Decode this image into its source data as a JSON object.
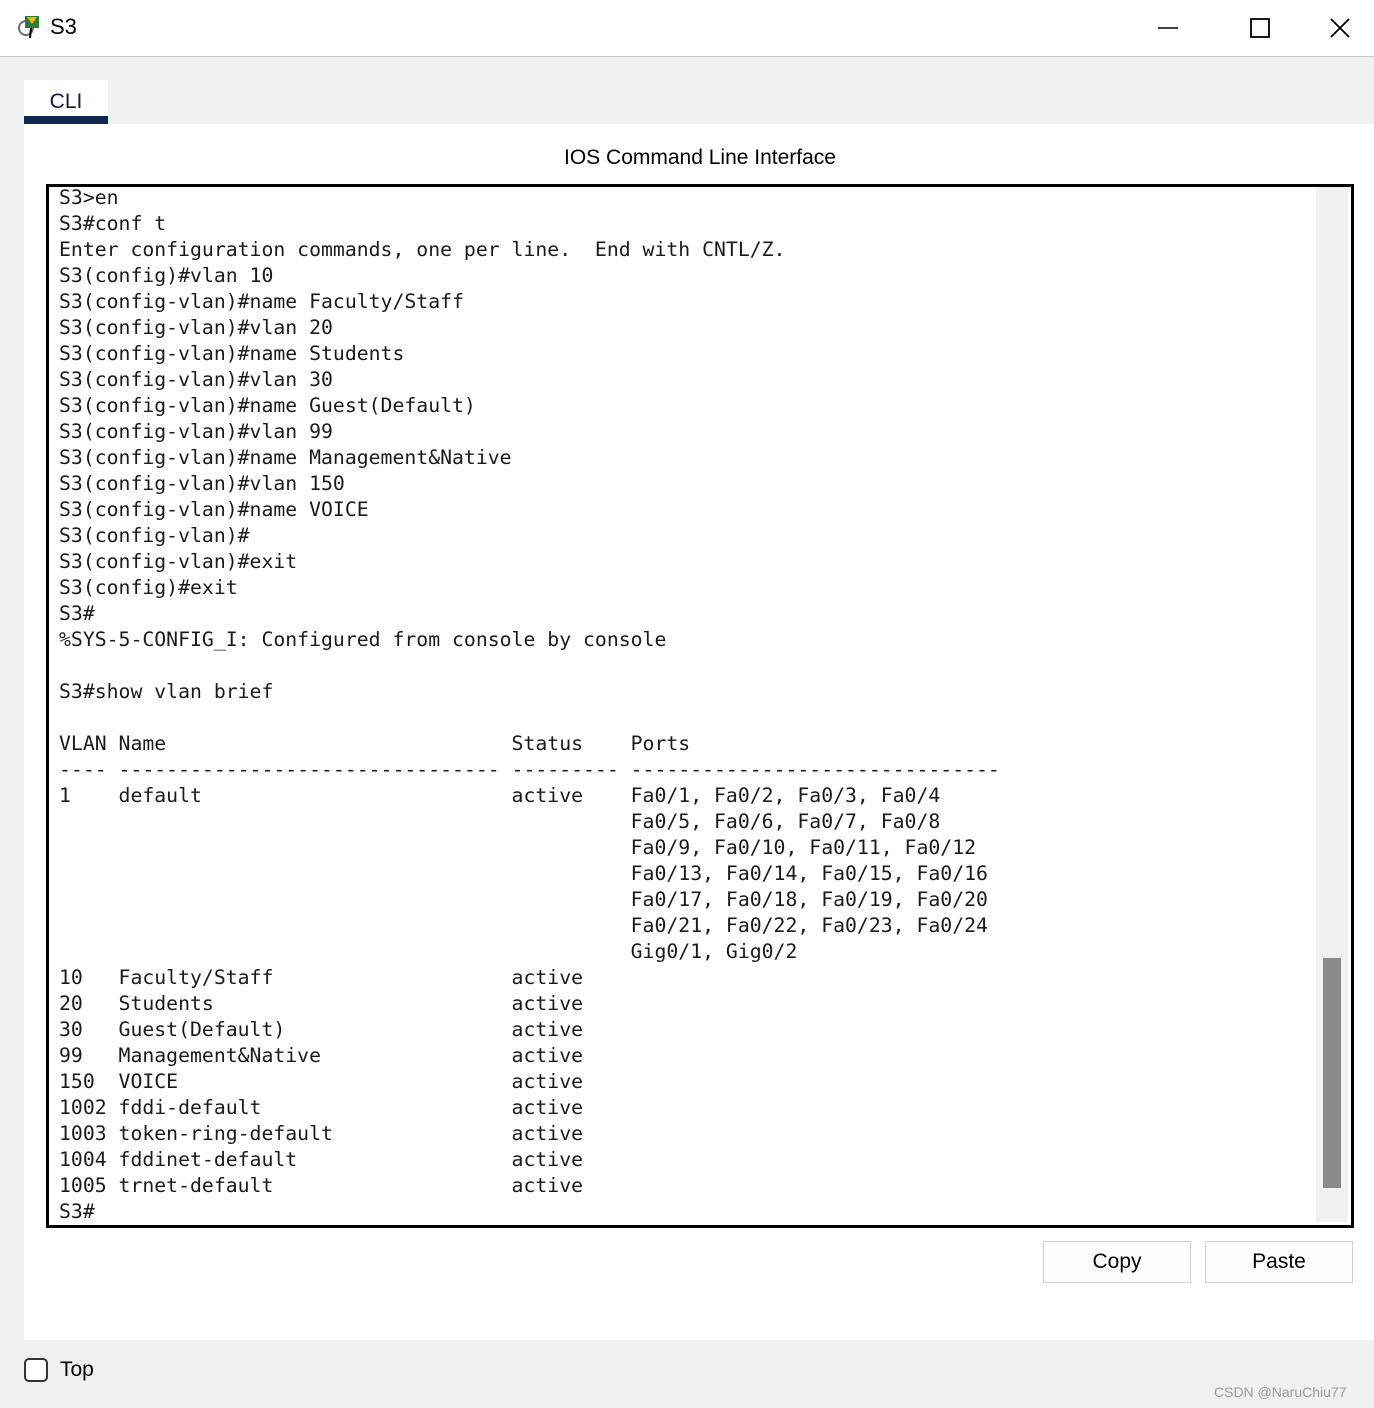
{
  "window": {
    "title": "S3",
    "icon": "packet-tracer-switch-icon",
    "controls": [
      "minimize-icon",
      "maximize-icon",
      "close-icon"
    ]
  },
  "tabs": [
    {
      "label": "CLI",
      "active": true
    }
  ],
  "panel": {
    "heading": "IOS Command Line Interface"
  },
  "terminal": {
    "lines": [
      "S3>en",
      "S3#conf t",
      "Enter configuration commands, one per line.  End with CNTL/Z.",
      "S3(config)#vlan 10",
      "S3(config-vlan)#name Faculty/Staff",
      "S3(config-vlan)#vlan 20",
      "S3(config-vlan)#name Students",
      "S3(config-vlan)#vlan 30",
      "S3(config-vlan)#name Guest(Default)",
      "S3(config-vlan)#vlan 99",
      "S3(config-vlan)#name Management&Native",
      "S3(config-vlan)#vlan 150",
      "S3(config-vlan)#name VOICE",
      "S3(config-vlan)#",
      "S3(config-vlan)#exit",
      "S3(config)#exit",
      "S3#",
      "%SYS-5-CONFIG_I: Configured from console by console",
      "",
      "S3#show vlan brief",
      "",
      "VLAN Name                             Status    Ports",
      "---- -------------------------------- --------- -------------------------------",
      "1    default                          active    Fa0/1, Fa0/2, Fa0/3, Fa0/4",
      "                                                Fa0/5, Fa0/6, Fa0/7, Fa0/8",
      "                                                Fa0/9, Fa0/10, Fa0/11, Fa0/12",
      "                                                Fa0/13, Fa0/14, Fa0/15, Fa0/16",
      "                                                Fa0/17, Fa0/18, Fa0/19, Fa0/20",
      "                                                Fa0/21, Fa0/22, Fa0/23, Fa0/24",
      "                                                Gig0/1, Gig0/2",
      "10   Faculty/Staff                    active    ",
      "20   Students                         active    ",
      "30   Guest(Default)                   active    ",
      "99   Management&Native                active    ",
      "150  VOICE                            active    ",
      "1002 fddi-default                     active    ",
      "1003 token-ring-default               active    ",
      "1004 fddinet-default                  active    ",
      "1005 trnet-default                    active    ",
      "S3#"
    ]
  },
  "buttons": {
    "copy": "Copy",
    "paste": "Paste"
  },
  "footer": {
    "top_checkbox_label": "Top",
    "top_checked": false,
    "watermark": "CSDN @NaruChiu77"
  },
  "colors": {
    "tab_underline": "#0e2a4e",
    "scroll_thumb": "#898989",
    "window_bg": "#f0f0f0"
  }
}
